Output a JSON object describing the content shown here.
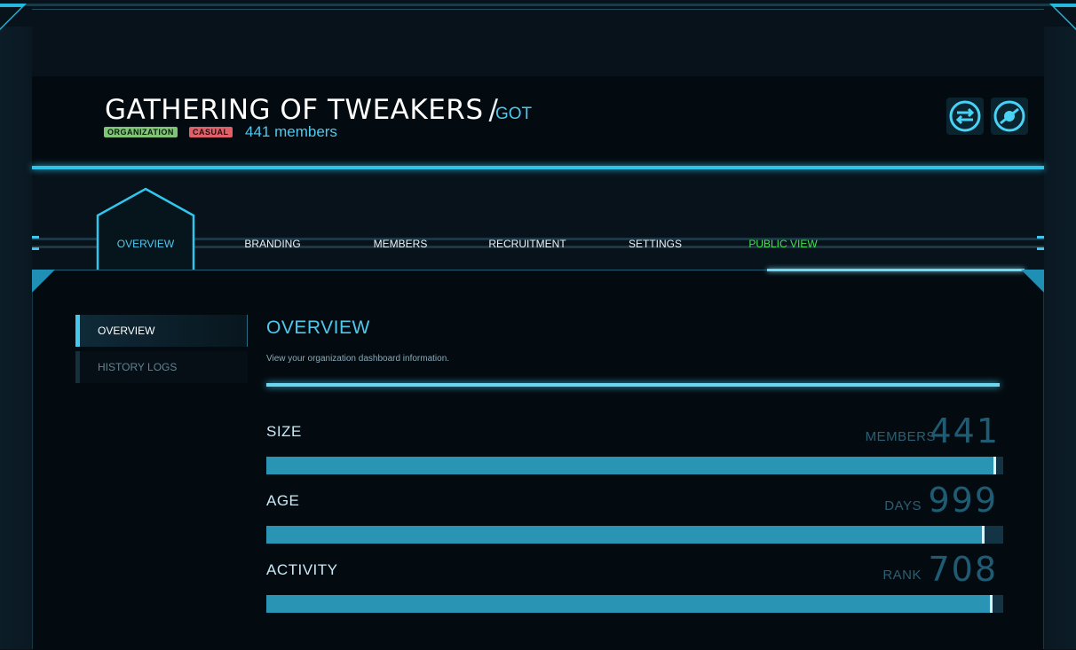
{
  "org": {
    "name": "GATHERING OF TWEAKERS",
    "slash": "/",
    "sid": "GOT",
    "badges": [
      "ORGANIZATION",
      "CASUAL"
    ],
    "members_text": "441 members"
  },
  "header_buttons": [
    {
      "icon": "switch-arrows-icon"
    },
    {
      "icon": "planet-icon"
    }
  ],
  "nav": {
    "items": [
      {
        "label": "OVERVIEW",
        "active": true
      },
      {
        "label": "BRANDING"
      },
      {
        "label": "MEMBERS"
      },
      {
        "label": "RECRUITMENT"
      },
      {
        "label": "SETTINGS"
      },
      {
        "label": "PUBLIC VIEW",
        "color": "#3ee24a"
      }
    ]
  },
  "sidebar": {
    "items": [
      {
        "label": "OVERVIEW",
        "active": true
      },
      {
        "label": "HISTORY LOGS"
      }
    ]
  },
  "main": {
    "title": "OVERVIEW",
    "description": "View your organization dashboard information.",
    "stats": [
      {
        "label": "SIZE",
        "unit": "MEMBERS",
        "value": "441",
        "fill": 0.99
      },
      {
        "label": "AGE",
        "unit": "DAYS",
        "value": "999",
        "fill": 0.975
      },
      {
        "label": "ACTIVITY",
        "unit": "RANK",
        "value": "708",
        "fill": 0.985
      }
    ]
  },
  "colors": {
    "accent": "#4fc8ee",
    "bar_fill": "#2a94b4",
    "bar_track": "#123444",
    "badge_org": "#7fc573",
    "badge_casual": "#e0606a",
    "public_view": "#3ee24a"
  }
}
